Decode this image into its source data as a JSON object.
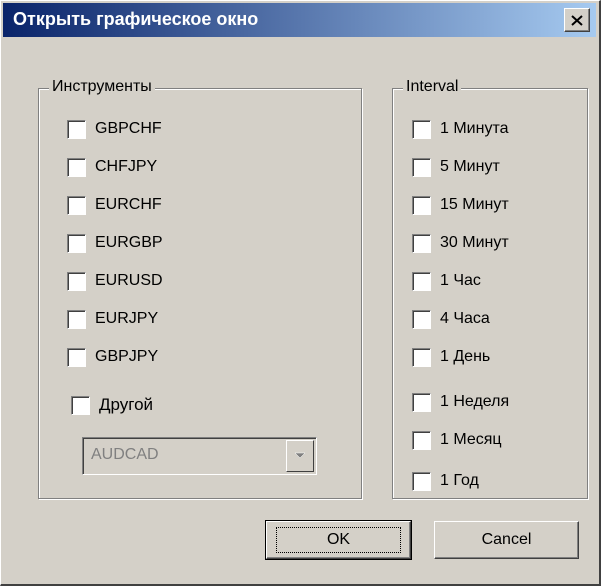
{
  "window": {
    "title": "Открыть графическое окно",
    "colors": {
      "face": "#d4d0c8",
      "title_start": "#0a246a",
      "title_end": "#a6caf0",
      "disabled_text": "#808080"
    }
  },
  "instruments": {
    "legend": "Инструменты",
    "items": [
      "GBPCHF",
      "CHFJPY",
      "EURCHF",
      "EURGBP",
      "EURUSD",
      "EURJPY",
      "GBPJPY"
    ],
    "other_label": "Другой",
    "combo_value": "AUDCAD"
  },
  "interval": {
    "legend": "Interval",
    "items": [
      "1 Минута",
      "5 Минут",
      "15 Минут",
      "30 Минут",
      "1 Час",
      "4 Часа",
      "1 День",
      "1 Неделя",
      "1 Месяц",
      "1 Год"
    ]
  },
  "buttons": {
    "ok": "OK",
    "cancel": "Cancel"
  },
  "icons": {
    "close": "close-icon",
    "dropdown": "chevron-down-icon"
  }
}
